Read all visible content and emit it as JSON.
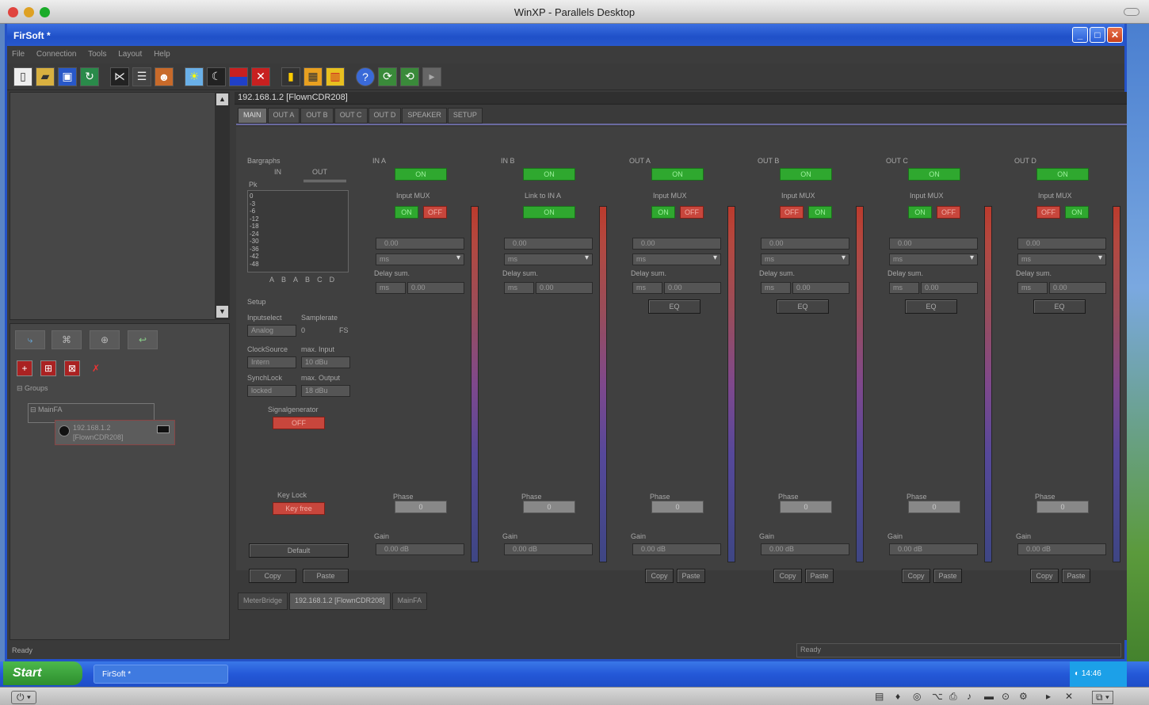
{
  "mac_window": {
    "title": "WinXP - Parallels Desktop"
  },
  "app": {
    "title": "FirSoft *"
  },
  "menu": [
    "File",
    "Connection",
    "Tools",
    "Layout",
    "Help"
  ],
  "device": {
    "address": "192.168.1.2 [FlownCDR208]",
    "line1": "192.168.1.2",
    "line2": "[FlownCDR208]"
  },
  "tree": {
    "root": "Groups",
    "group": "MainFA"
  },
  "tabs": [
    "MAIN",
    "OUT A",
    "OUT B",
    "OUT C",
    "OUT D",
    "SPEAKER",
    "SETUP"
  ],
  "setup_panel": {
    "bargraphs_label": "Bargraphs",
    "in_label": "IN",
    "out_label": "OUT",
    "pk_label": "Pk",
    "db_scale": [
      "0",
      "-3",
      "-6",
      "-12",
      "-18",
      "-24",
      "-30",
      "-36",
      "-42",
      "-48"
    ],
    "channel_letters": [
      "A",
      "B",
      "A",
      "B",
      "C",
      "D"
    ],
    "setup_label": "Setup",
    "inputselect_label": "Inputselect",
    "samplerate_label": "Samplerate",
    "inputselect_value": "Analog",
    "samplerate_value": "0",
    "samplerate_unit": "FS",
    "clocksource_label": "ClockSource",
    "maxinput_label": "max. Input",
    "clocksource_value": "Intern",
    "maxinput_value": "10 dBu",
    "synchlock_label": "SynchLock",
    "maxoutput_label": "max. Output",
    "synchlock_value": "locked",
    "maxoutput_value": "18 dBu",
    "siggen_label": "Signalgenerator",
    "siggen_value": "OFF",
    "keylock_label": "Key Lock",
    "keylock_value": "Key free",
    "default_label": "Default",
    "copy_label": "Copy",
    "paste_label": "Paste"
  },
  "channels": [
    {
      "name": "IN A",
      "on": "ON",
      "mux_label": "Input MUX",
      "mux_a": "ON",
      "mux_b": "OFF",
      "delay": "0.00",
      "unit": "ms",
      "delay_sum_label": "Delay sum.",
      "delay_sum": "0.00",
      "eq": "",
      "phase_label": "Phase",
      "phase": "0",
      "gain_label": "Gain",
      "gain": "0.00 dB",
      "copy": "",
      "paste": ""
    },
    {
      "name": "IN B",
      "on": "ON",
      "mux_label": "Link to IN A",
      "mux_a": "ON",
      "mux_b": "",
      "delay": "0.00",
      "unit": "ms",
      "delay_sum_label": "Delay sum.",
      "delay_sum": "0.00",
      "eq": "",
      "phase_label": "Phase",
      "phase": "0",
      "gain_label": "Gain",
      "gain": "0.00 dB",
      "copy": "",
      "paste": ""
    },
    {
      "name": "OUT A",
      "on": "ON",
      "mux_label": "Input MUX",
      "mux_a": "ON",
      "mux_b": "OFF",
      "delay": "0.00",
      "unit": "ms",
      "delay_sum_label": "Delay sum.",
      "delay_sum": "0.00",
      "eq": "EQ",
      "phase_label": "Phase",
      "phase": "0",
      "gain_label": "Gain",
      "gain": "0.00 dB",
      "copy": "Copy",
      "paste": "Paste"
    },
    {
      "name": "OUT B",
      "on": "ON",
      "mux_label": "Input MUX",
      "mux_a": "OFF",
      "mux_b": "ON",
      "delay": "0.00",
      "unit": "ms",
      "delay_sum_label": "Delay sum.",
      "delay_sum": "0.00",
      "eq": "EQ",
      "phase_label": "Phase",
      "phase": "0",
      "gain_label": "Gain",
      "gain": "0.00 dB",
      "copy": "Copy",
      "paste": "Paste"
    },
    {
      "name": "OUT C",
      "on": "ON",
      "mux_label": "Input MUX",
      "mux_a": "ON",
      "mux_b": "OFF",
      "delay": "0.00",
      "unit": "ms",
      "delay_sum_label": "Delay sum.",
      "delay_sum": "0.00",
      "eq": "EQ",
      "phase_label": "Phase",
      "phase": "0",
      "gain_label": "Gain",
      "gain": "0.00 dB",
      "copy": "Copy",
      "paste": "Paste"
    },
    {
      "name": "OUT D",
      "on": "ON",
      "mux_label": "Input MUX",
      "mux_a": "OFF",
      "mux_b": "ON",
      "delay": "0.00",
      "unit": "ms",
      "delay_sum_label": "Delay sum.",
      "delay_sum": "0.00",
      "eq": "EQ",
      "phase_label": "Phase",
      "phase": "0",
      "gain_label": "Gain",
      "gain": "0.00 dB",
      "copy": "Copy",
      "paste": "Paste"
    }
  ],
  "bottom_tabs": [
    "MeterBridge",
    "192.168.1.2 [FlownCDR208]",
    "MainFA"
  ],
  "status": {
    "left": "Ready",
    "right": "Ready"
  },
  "taskbar": {
    "start": "Start",
    "task": "FirSoft *",
    "clock": "14:46"
  },
  "colors": {
    "on_green": "#2fa82f",
    "off_red": "#c8463c",
    "xp_blue": "#2452c8",
    "panel": "#404040"
  }
}
